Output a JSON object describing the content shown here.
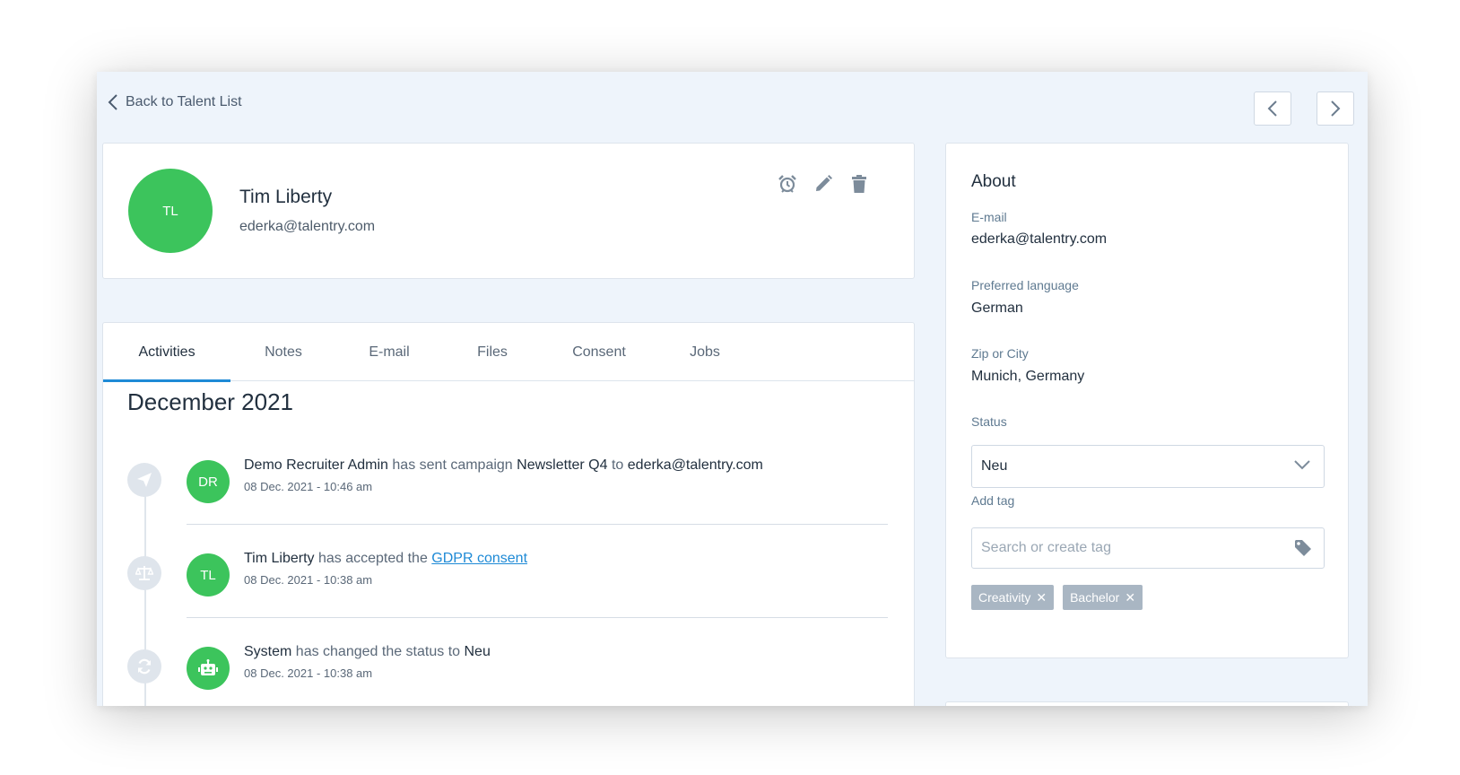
{
  "header": {
    "back_label": "Back to Talent List"
  },
  "profile": {
    "initials": "TL",
    "name": "Tim Liberty",
    "email": "ederka@talentry.com",
    "avatar_color": "#3cc45c",
    "actions": [
      "alarm-clock-icon",
      "pencil-icon",
      "trash-icon"
    ]
  },
  "tabs": [
    {
      "label": "Activities",
      "active": true
    },
    {
      "label": "Notes"
    },
    {
      "label": "E-mail"
    },
    {
      "label": "Files"
    },
    {
      "label": "Consent"
    },
    {
      "label": "Jobs"
    }
  ],
  "timeline": {
    "month": "December 2021",
    "items": [
      {
        "icon": "paper-plane-icon",
        "avatar": "DR",
        "actor": "Demo Recruiter Admin",
        "middle": " has sent campaign ",
        "object": "Newsletter Q4",
        "middle2": " to ",
        "target": "ederka@talentry.com",
        "time": "08 Dec. 2021 - 10:46 am"
      },
      {
        "icon": "scales-icon",
        "avatar": "TL",
        "actor": "Tim Liberty",
        "middle": " has accepted the ",
        "link": "GDPR consent",
        "time": "08 Dec. 2021 - 10:38 am"
      },
      {
        "icon": "refresh-icon",
        "avatar": "robot-icon",
        "actor": "System",
        "middle": " has changed the status to ",
        "object": "Neu",
        "time": "08 Dec. 2021 - 10:38 am"
      }
    ]
  },
  "about": {
    "title": "About",
    "email_label": "E-mail",
    "email_value": "ederka@talentry.com",
    "language_label": "Preferred language",
    "language_value": "German",
    "city_label": "Zip or City",
    "city_value": "Munich, Germany",
    "status_label": "Status",
    "status_value": "Neu",
    "tag_label": "Add tag",
    "tag_placeholder": "Search or create tag",
    "tags": [
      "Creativity",
      "Bachelor"
    ]
  },
  "colors": {
    "accent": "#1e8ad6",
    "avatar_green": "#3cc45c",
    "tag_chip": "#a9b6c3",
    "background": "#eef4fb"
  }
}
